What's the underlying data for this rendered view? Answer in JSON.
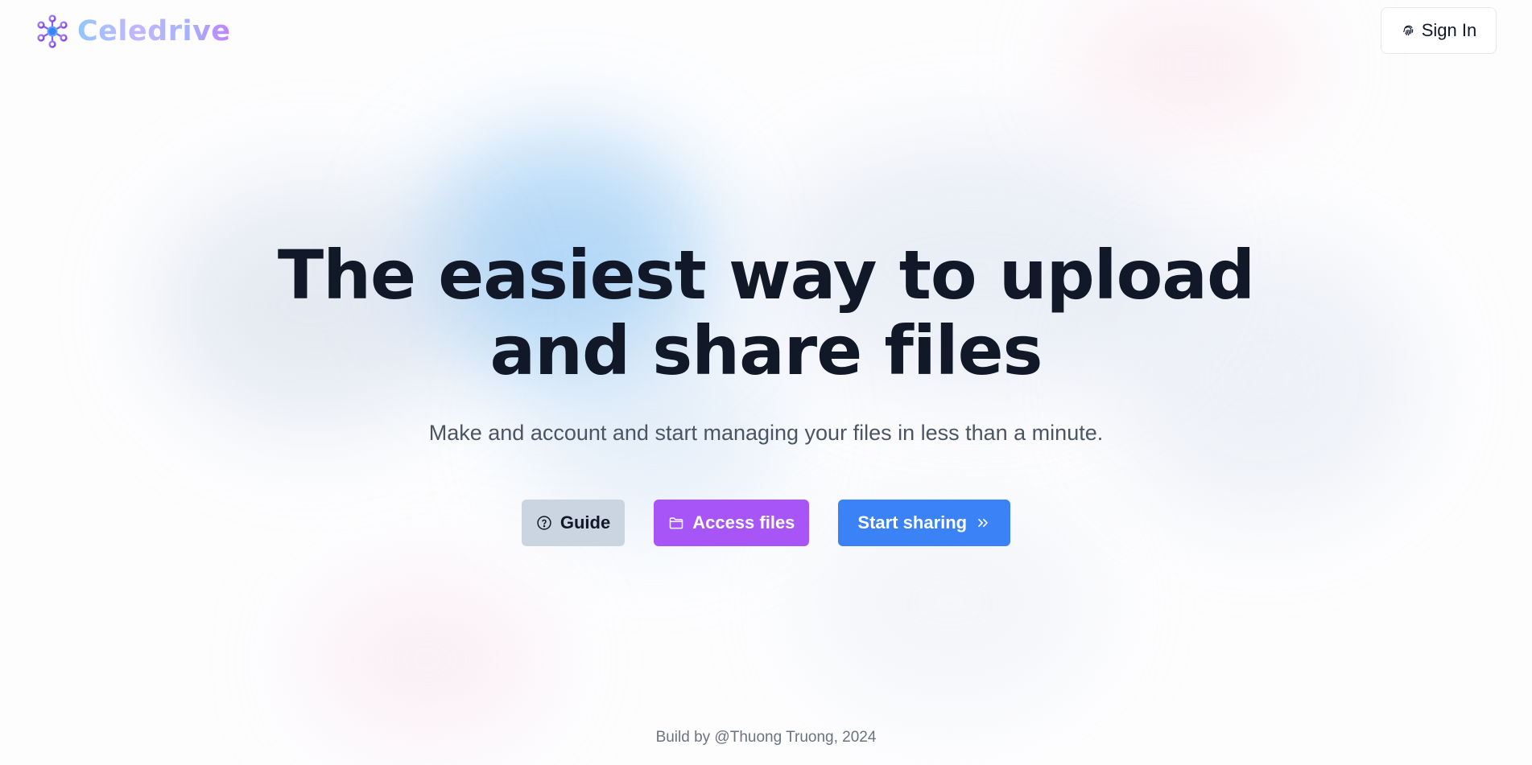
{
  "app": {
    "name": "Celedrive"
  },
  "header": {
    "logo_icon": "network-molecule-icon",
    "signin_label": "Sign In",
    "signin_icon": "fingerprint-icon"
  },
  "hero": {
    "headline_line1": "The easiest way to upload",
    "headline_line2": "and share files",
    "subtitle": "Make and account and start managing your files in less than a minute."
  },
  "actions": {
    "guide": {
      "label": "Guide",
      "icon": "question-circle-icon",
      "color": "#cbd5e1"
    },
    "access": {
      "label": "Access files",
      "icon": "folder-icon",
      "color": "#a855f7"
    },
    "start": {
      "label": "Start sharing",
      "icon": "chevrons-right-icon",
      "color": "#3b82f6"
    }
  },
  "footer": {
    "text": "Build by @Thuong Truong, 2024"
  }
}
